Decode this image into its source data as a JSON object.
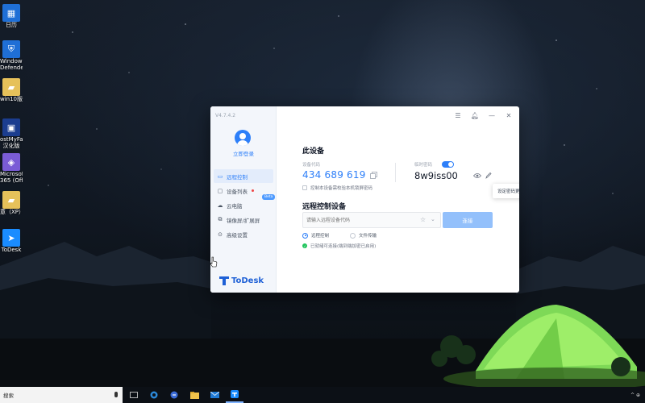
{
  "desktop": {
    "icons": [
      {
        "name": "calendar-app",
        "label": "日历",
        "glyph": "▦",
        "color": "#1f6fd6"
      },
      {
        "name": "windows-defender",
        "label": "Windows\nDefender",
        "glyph": "⛨",
        "color": "#1f6fd6"
      },
      {
        "name": "win10-folder",
        "label": "win10版",
        "glyph": "▰",
        "color": "#e6c15a"
      },
      {
        "name": "fixmyfault",
        "label": "ostMyFault\n汉化版",
        "glyph": "▣",
        "color": "#1b3d8f"
      },
      {
        "name": "microsoft-365",
        "label": "Microsoft\n365 (Office)",
        "glyph": "◈",
        "color": "#7a5cd6"
      },
      {
        "name": "xp-folder",
        "label": "意（XP）",
        "glyph": "▰",
        "color": "#e6c15a"
      },
      {
        "name": "todesk-shortcut",
        "label": "ToDesk",
        "glyph": "➤",
        "color": "#1a8cff"
      }
    ]
  },
  "window": {
    "version": "V4.7.4.2",
    "login_label": "立即登录",
    "nav": [
      {
        "id": "remote-control",
        "label": "远程控制",
        "icon": "▭",
        "active": true
      },
      {
        "id": "device-list",
        "label": "设备列表",
        "icon": "▢",
        "dot": true
      },
      {
        "id": "cloud-pc",
        "label": "云电脑",
        "icon": "☁",
        "badge": "Beta"
      },
      {
        "id": "mirror-screen",
        "label": "镜像屏/扩展屏",
        "icon": "⧉"
      },
      {
        "id": "advanced-settings",
        "label": "高级设置",
        "icon": "⊙"
      }
    ],
    "logo_text": "ToDesk",
    "this_device": {
      "title": "此设备",
      "code_label": "设备代码",
      "code": "434 689 619",
      "temp_label": "临时密码",
      "temp_password": "8w9iss00",
      "checkbox_label": "控制本设备需校验本机锁屏密码"
    },
    "tooltip": "设定密码更新频率在这里",
    "remote": {
      "title": "远程控制设备",
      "input_placeholder": "请输入远程设备代码",
      "connect_label": "连接",
      "modes": [
        "远程控制",
        "文件传输"
      ],
      "status": "已就绪可连接(端到端加密已启用)"
    }
  },
  "taskbar": {
    "search_text": "搜索",
    "tray_time": "^ ⊕"
  },
  "colors": {
    "accent": "#2d7ff9",
    "connect_disabled": "#93c0fb",
    "status_ok": "#22c55e"
  }
}
